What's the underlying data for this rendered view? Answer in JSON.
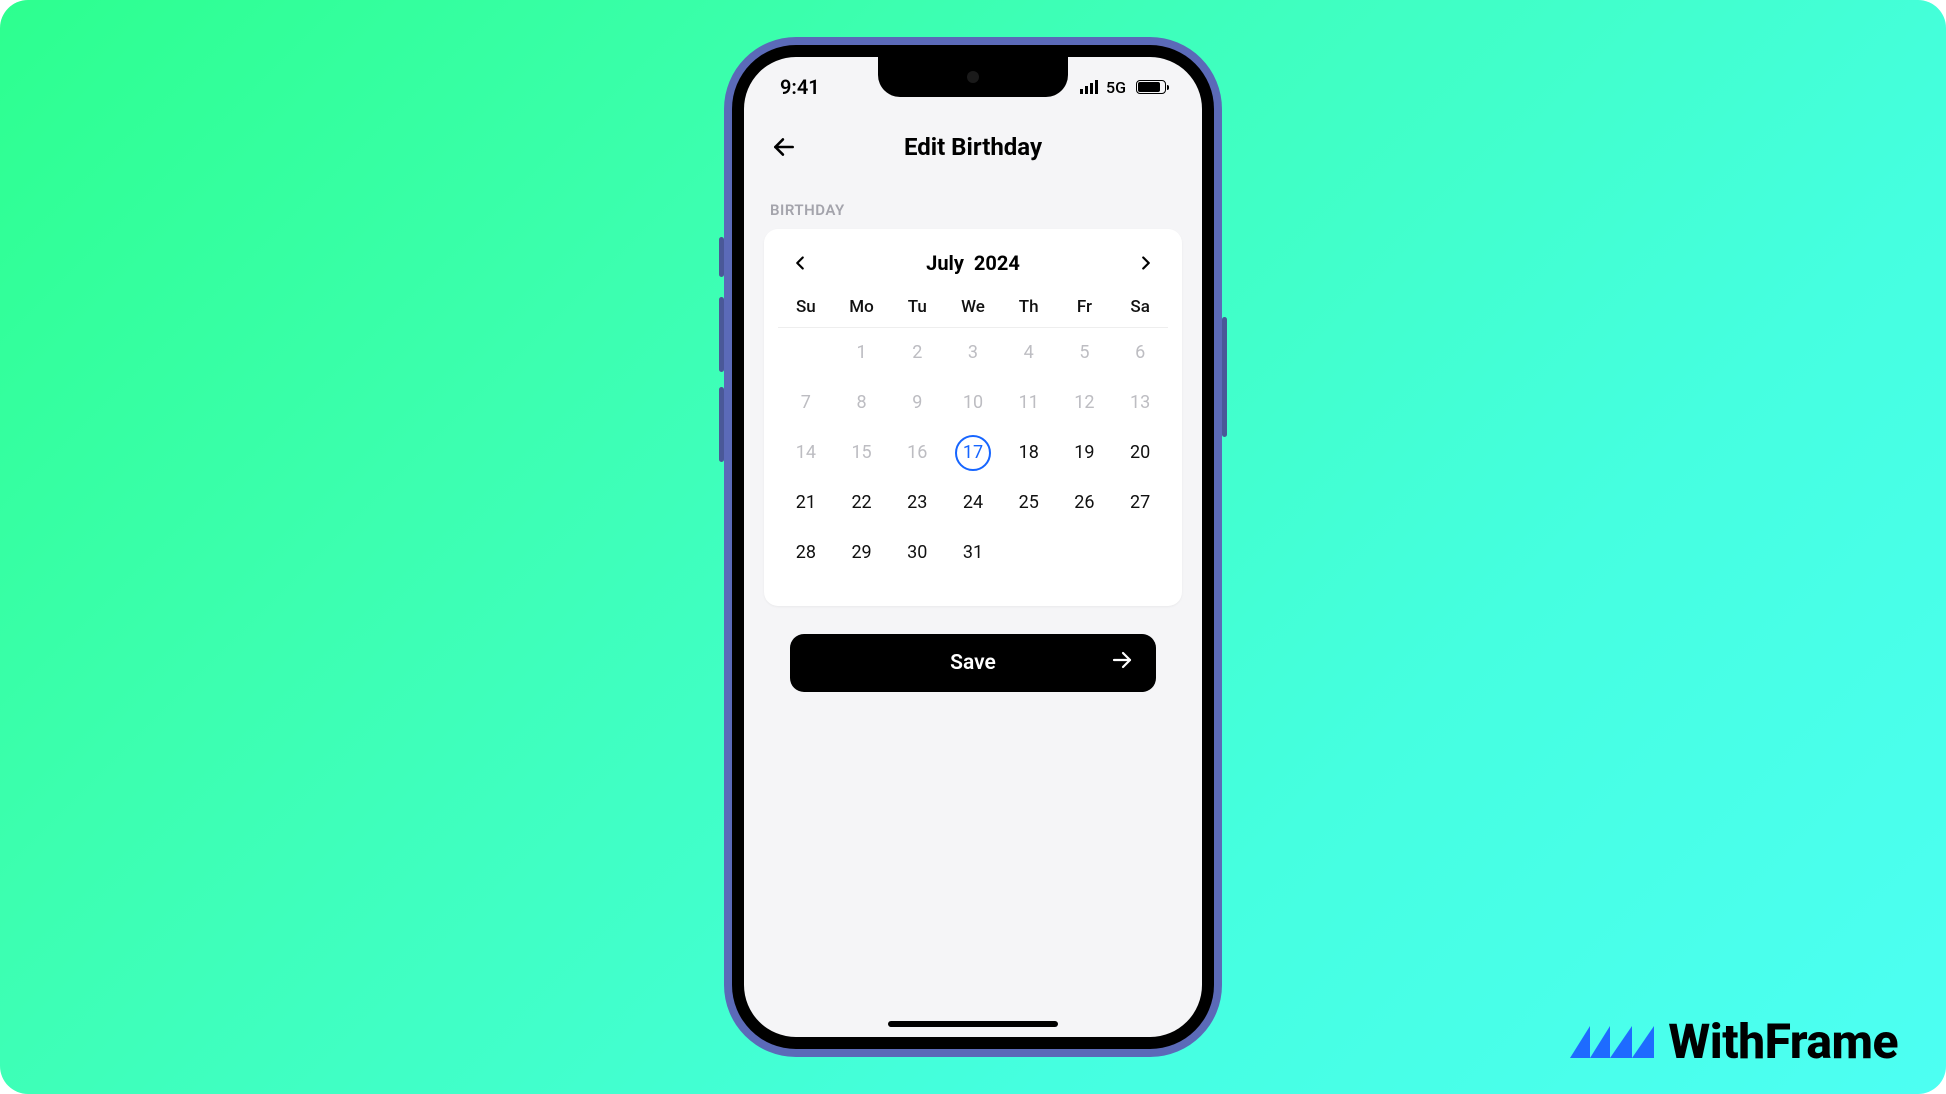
{
  "status_bar": {
    "time": "9:41",
    "network_label": "5G"
  },
  "header": {
    "title": "Edit Birthday"
  },
  "section": {
    "label": "BIRTHDAY"
  },
  "calendar": {
    "month": "July",
    "year": "2024",
    "dow": [
      "Su",
      "Mo",
      "Tu",
      "We",
      "Th",
      "Fr",
      "Sa"
    ],
    "days": [
      {
        "n": "1",
        "state": "past"
      },
      {
        "n": "2",
        "state": "past"
      },
      {
        "n": "3",
        "state": "past"
      },
      {
        "n": "4",
        "state": "past"
      },
      {
        "n": "5",
        "state": "past"
      },
      {
        "n": "6",
        "state": "past"
      },
      {
        "n": "7",
        "state": "past"
      },
      {
        "n": "8",
        "state": "past"
      },
      {
        "n": "9",
        "state": "past"
      },
      {
        "n": "10",
        "state": "past"
      },
      {
        "n": "11",
        "state": "past"
      },
      {
        "n": "12",
        "state": "past"
      },
      {
        "n": "13",
        "state": "past"
      },
      {
        "n": "14",
        "state": "past"
      },
      {
        "n": "15",
        "state": "past"
      },
      {
        "n": "16",
        "state": "past"
      },
      {
        "n": "17",
        "state": "today"
      },
      {
        "n": "18",
        "state": "future"
      },
      {
        "n": "19",
        "state": "future"
      },
      {
        "n": "20",
        "state": "future"
      },
      {
        "n": "21",
        "state": "future"
      },
      {
        "n": "22",
        "state": "future"
      },
      {
        "n": "23",
        "state": "future"
      },
      {
        "n": "24",
        "state": "future"
      },
      {
        "n": "25",
        "state": "future"
      },
      {
        "n": "26",
        "state": "future"
      },
      {
        "n": "27",
        "state": "future"
      },
      {
        "n": "28",
        "state": "future"
      },
      {
        "n": "29",
        "state": "future"
      },
      {
        "n": "30",
        "state": "future"
      },
      {
        "n": "31",
        "state": "future"
      }
    ],
    "first_day_col": 1
  },
  "actions": {
    "save_label": "Save"
  },
  "brand": {
    "name": "WithFrame"
  },
  "colors": {
    "accent": "#1665ff"
  }
}
